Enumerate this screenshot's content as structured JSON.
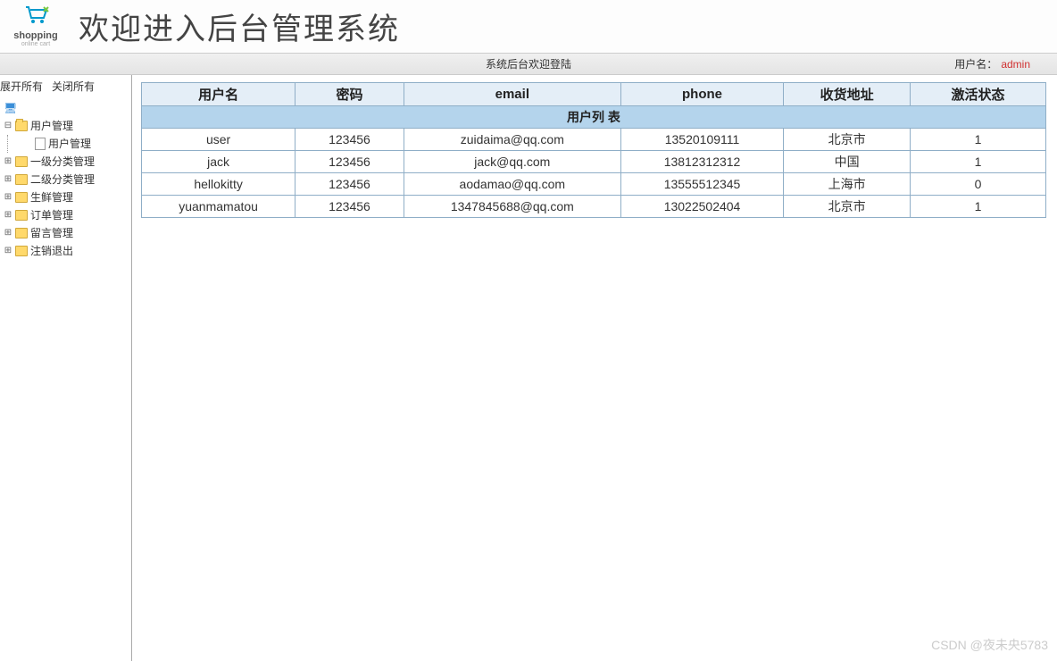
{
  "logo": {
    "text": "shopping",
    "sub": "online cart"
  },
  "header": {
    "title": "欢迎进入后台管理系统"
  },
  "subheader": {
    "welcome": "系统后台欢迎登陆",
    "userLabel": "用户名：",
    "username": "admin"
  },
  "sidebar": {
    "expandAll": "展开所有",
    "collapseAll": "关闭所有",
    "items": [
      {
        "label": "用户管理",
        "expanded": true,
        "children": [
          {
            "label": "用户管理"
          }
        ]
      },
      {
        "label": "一级分类管理",
        "expanded": false
      },
      {
        "label": "二级分类管理",
        "expanded": false
      },
      {
        "label": "生鲜管理",
        "expanded": false
      },
      {
        "label": "订单管理",
        "expanded": false
      },
      {
        "label": "留言管理",
        "expanded": false
      },
      {
        "label": "注销退出",
        "expanded": false
      }
    ]
  },
  "table": {
    "title": "用户列 表",
    "headers": [
      "用户名",
      "密码",
      "email",
      "phone",
      "收货地址",
      "激活状态"
    ],
    "rows": [
      {
        "username": "user",
        "password": "123456",
        "email": "zuidaima@qq.com",
        "phone": "13520109111",
        "address": "北京市",
        "active": "1"
      },
      {
        "username": "jack",
        "password": "123456",
        "email": "jack@qq.com",
        "phone": "13812312312",
        "address": "中国",
        "active": "1"
      },
      {
        "username": "hellokitty",
        "password": "123456",
        "email": "aodamao@qq.com",
        "phone": "13555512345",
        "address": "上海市",
        "active": "0"
      },
      {
        "username": "yuanmamatou",
        "password": "123456",
        "email": "1347845688@qq.com",
        "phone": "13022502404",
        "address": "北京市",
        "active": "1"
      }
    ]
  },
  "watermark": "CSDN @夜未央5783"
}
